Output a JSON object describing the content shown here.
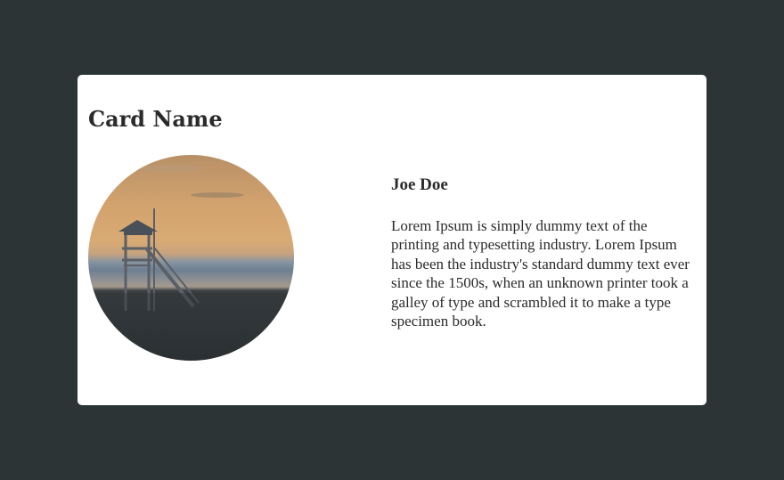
{
  "card": {
    "title": "Card Name",
    "image": {
      "subject": "lifeguard-tower-at-beach-sunset",
      "colors": {
        "sky_top": "#c79d6c",
        "sky_mid": "#d8a86f",
        "horizon_blue": "#6a7c8e",
        "sand": "#2f3437"
      }
    },
    "person": {
      "name": "Joe Doe",
      "description": "Lorem Ipsum is simply dummy text of the printing and typesetting industry. Lorem Ipsum has been the industry's standard dummy text ever since the 1500s, when an unknown printer took a galley of type and scrambled it to make a type specimen book."
    }
  },
  "colors": {
    "page_background": "#2c3436",
    "card_background": "#ffffff",
    "text": "#2b2b2b"
  }
}
